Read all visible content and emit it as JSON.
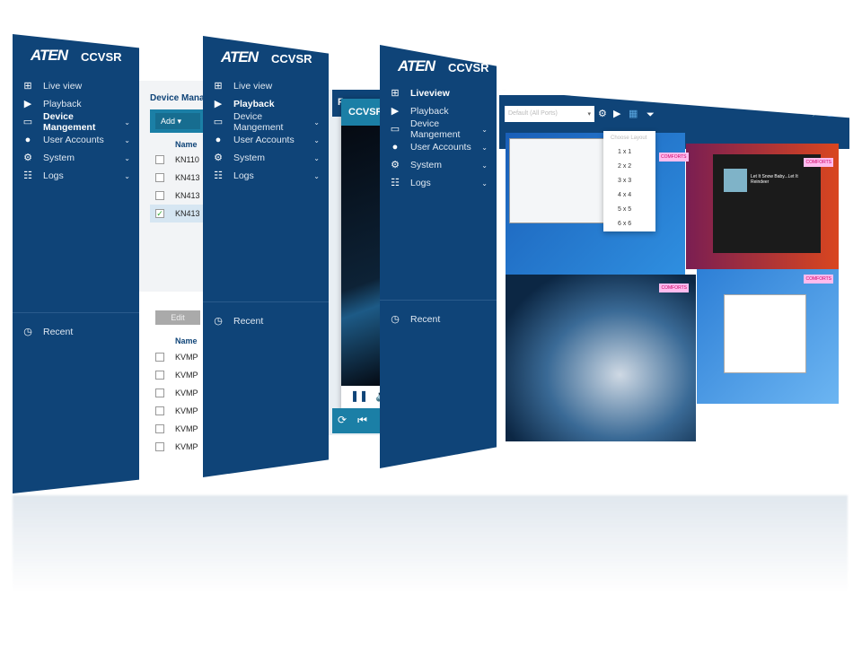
{
  "brand": {
    "logo": "ATEN",
    "product": "CCVSR"
  },
  "panel1": {
    "nav": [
      {
        "label": "Live view",
        "icon": "grid-icon"
      },
      {
        "label": "Playback",
        "icon": "play-icon"
      },
      {
        "label": "Device Mangement",
        "icon": "drive-icon",
        "active": true
      },
      {
        "label": "User Accounts",
        "icon": "user-icon"
      },
      {
        "label": "System",
        "icon": "gear-icon"
      },
      {
        "label": "Logs",
        "icon": "list-icon"
      }
    ],
    "recent": "Recent",
    "content": {
      "title": "Device Manag",
      "add": "Add",
      "name_header": "Name",
      "rows": [
        "KN110",
        "KN413",
        "KN413",
        "KN413"
      ],
      "checked_row": 3,
      "edit": "Edit",
      "name_header2": "Name",
      "rows2": [
        "KVMP",
        "KVMP",
        "KVMP",
        "KVMP",
        "KVMP",
        "KVMP"
      ]
    }
  },
  "panel2": {
    "nav": [
      {
        "label": "Live view",
        "icon": "grid-icon"
      },
      {
        "label": "Playback",
        "icon": "play-icon",
        "active": true
      },
      {
        "label": "Device Mangement",
        "icon": "drive-icon"
      },
      {
        "label": "User Accounts",
        "icon": "user-icon"
      },
      {
        "label": "System",
        "icon": "gear-icon"
      },
      {
        "label": "Logs",
        "icon": "list-icon"
      }
    ],
    "recent": "Recent",
    "content": {
      "title_fragment": "P",
      "window_title": "CCVSR"
    }
  },
  "panel3": {
    "nav": [
      {
        "label": "Liveview",
        "icon": "grid-icon",
        "active": true
      },
      {
        "label": "Playback",
        "icon": "play-icon"
      },
      {
        "label": "Device Mangement",
        "icon": "drive-icon"
      },
      {
        "label": "User Accounts",
        "icon": "user-icon"
      },
      {
        "label": "System",
        "icon": "gear-icon"
      },
      {
        "label": "Logs",
        "icon": "list-icon"
      }
    ],
    "recent": "Recent",
    "toolbar": {
      "port_select": "Default (All Ports)"
    },
    "layout_menu": {
      "header": "Choose Layout",
      "options": [
        "1 x 1",
        "2 x 2",
        "3 x 3",
        "4 x 4",
        "5 x 5",
        "6 x 6"
      ]
    },
    "tiles": [
      {
        "badge": "COMFORTS"
      },
      {
        "badge": "COMFORTS"
      },
      {
        "badge": "COMFORTS"
      },
      {
        "badge": "COMFORTS"
      }
    ],
    "now_playing": "Let It Snow Baby...Let It Reindeer"
  },
  "colors": {
    "sidebar": "#0f4478",
    "accent": "#1b7fa6",
    "ubuntu": "#d9461f",
    "win": "#1f6fc2"
  }
}
